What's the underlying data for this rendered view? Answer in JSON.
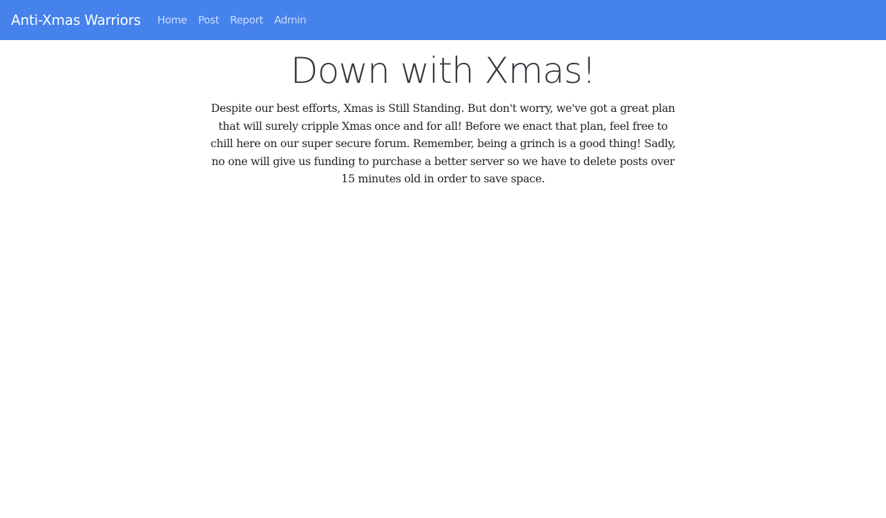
{
  "navbar": {
    "brand": "Anti-Xmas Warriors",
    "links": [
      "Home",
      "Post",
      "Report",
      "Admin"
    ],
    "background_color": "#4582ec"
  },
  "main": {
    "title": "Down with Xmas!",
    "intro": "Despite our best efforts, Xmas is Still Standing. But don't worry, we've got a great plan that will surely cripple Xmas once and for all! Before we enact that plan, feel free to chill here on our super secure forum. Remember, being a grinch is a good thing! Sadly, no one will give us funding to purchase a better server so we have to delete posts over 15 minutes old in order to save space."
  }
}
